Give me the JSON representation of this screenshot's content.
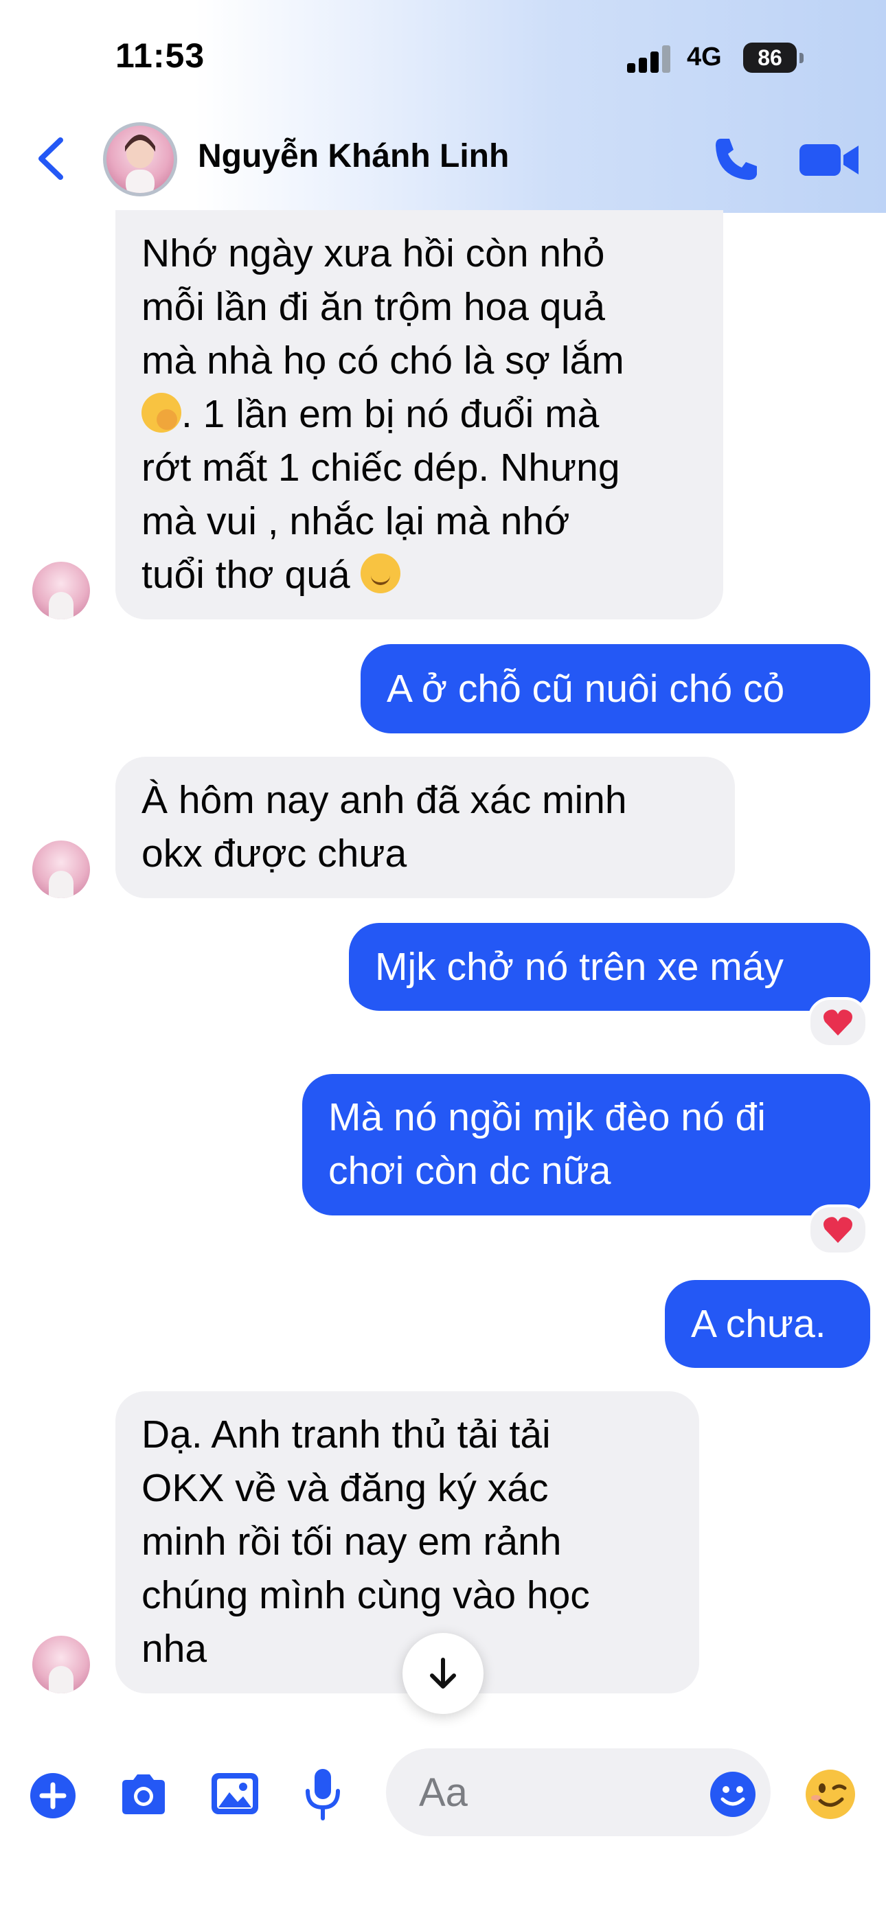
{
  "status_bar": {
    "time": "11:53",
    "network": "4G",
    "battery": "86"
  },
  "header": {
    "contact_name": "Nguyễn Khánh Linh",
    "back_icon": "chevron-left-icon",
    "call_icon": "phone-icon",
    "video_icon": "video-camera-icon",
    "accent_color": "#2458f5"
  },
  "messages": [
    {
      "direction": "incoming",
      "lines": [
        "Nhớ ngày xưa hồi còn nhỏ",
        "mỗi lần đi ăn trộm hoa quả",
        "mà nhà họ có chó là sợ lắm",
        ". 1 lần em bị nó đuổi mà",
        "rớt mất 1 chiếc dép. Nhưng",
        "mà vui , nhắc lại mà nhớ",
        "tuổi thơ quá"
      ]
    },
    {
      "direction": "outgoing",
      "lines": [
        "A ở chỗ cũ nuôi chó cỏ"
      ]
    },
    {
      "direction": "incoming",
      "lines": [
        "À hôm nay anh đã xác minh",
        "okx được chưa"
      ]
    },
    {
      "direction": "outgoing",
      "lines": [
        "Mjk chở nó trên xe máy"
      ],
      "reaction": "heart"
    },
    {
      "direction": "outgoing",
      "lines": [
        "Mà nó ngồi mjk đèo nó đi",
        "chơi còn dc nữa"
      ],
      "reaction": "heart"
    },
    {
      "direction": "outgoing",
      "lines": [
        "A chưa."
      ]
    },
    {
      "direction": "incoming",
      "lines": [
        "Dạ. Anh tranh thủ tải tải",
        "OKX về và đăng ký xác",
        "minh rồi tối nay em rảnh",
        "chúng mình cùng vào học",
        "nha"
      ]
    }
  ],
  "composer": {
    "placeholder": "Aa",
    "icons": [
      "plus-icon",
      "camera-icon",
      "image-icon",
      "microphone-icon",
      "emoji-icon",
      "winking-face-icon"
    ]
  }
}
